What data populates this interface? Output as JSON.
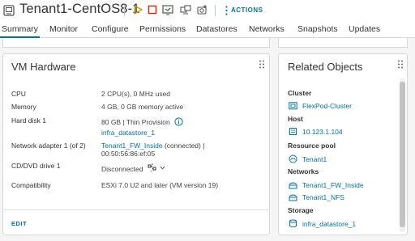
{
  "header": {
    "vm_name": "Tenant1-CentOS8-1",
    "actions_label": "ACTIONS",
    "toolbar_icons": [
      "power-on-icon",
      "power-off-icon",
      "launch-console-icon",
      "migrate-icon",
      "snapshot-icon"
    ]
  },
  "tabs": [
    {
      "label": "Summary",
      "active": true
    },
    {
      "label": "Monitor"
    },
    {
      "label": "Configure"
    },
    {
      "label": "Permissions"
    },
    {
      "label": "Datastores"
    },
    {
      "label": "Networks"
    },
    {
      "label": "Snapshots"
    },
    {
      "label": "Updates"
    }
  ],
  "vm_hardware": {
    "title": "VM Hardware",
    "rows": [
      {
        "label": "CPU",
        "value": "2 CPU(s), 0 MHz used"
      },
      {
        "label": "Memory",
        "value": "4 GB, 0 GB memory active"
      },
      {
        "label": "Hard disk 1",
        "value": "80 GB | Thin Provision",
        "value2": "infra_datastore_1"
      },
      {
        "label": "Network adapter 1 (of 2)",
        "value": "Tenant1_FW_Inside",
        "value_suffix": " (connected) |",
        "value2": "00:50:56:86:ef:05"
      },
      {
        "label": "CD/DVD drive 1",
        "value": "Disconnected"
      },
      {
        "label": "Compatibility",
        "value": "ESXi 7.0 U2 and later (VM version 19)"
      }
    ],
    "edit_label": "EDIT"
  },
  "related_objects": {
    "title": "Related Objects",
    "sections": [
      {
        "heading": "Cluster",
        "items": [
          {
            "label": "FlexPod-Cluster",
            "icon": "cluster-icon"
          }
        ]
      },
      {
        "heading": "Host",
        "items": [
          {
            "label": "10.123.1.104",
            "icon": "host-icon"
          }
        ]
      },
      {
        "heading": "Resource pool",
        "items": [
          {
            "label": "Tenant1",
            "icon": "resource-pool-icon"
          }
        ]
      },
      {
        "heading": "Networks",
        "items": [
          {
            "label": "Tenant1_FW_Inside",
            "icon": "network-icon"
          },
          {
            "label": "Tenant1_NFS",
            "icon": "network-icon"
          }
        ]
      },
      {
        "heading": "Storage",
        "items": [
          {
            "label": "infra_datastore_1",
            "icon": "datastore-icon"
          }
        ]
      }
    ]
  },
  "colors": {
    "accent": "#0072a3",
    "power_on": "#c99700",
    "power_off": "#e12200"
  }
}
